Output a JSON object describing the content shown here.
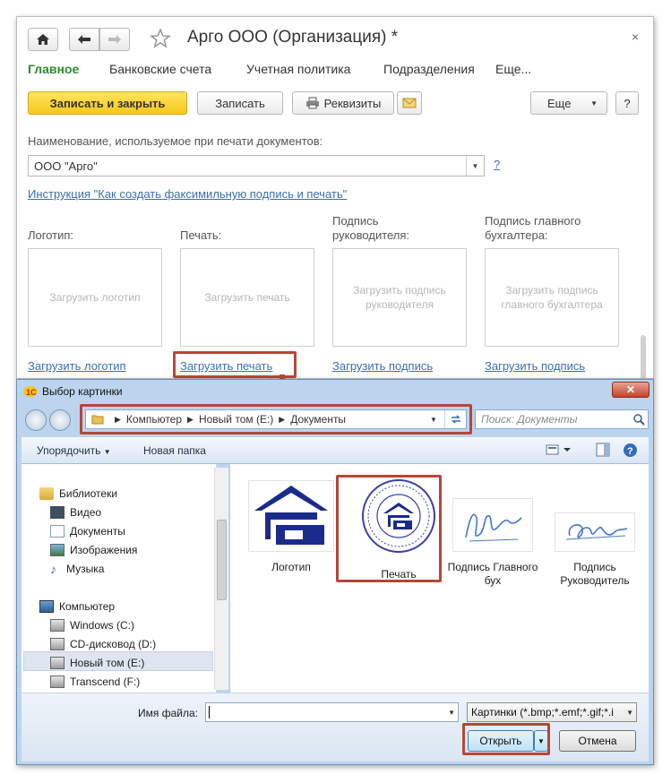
{
  "window": {
    "title": "Арго ООО (Организация) *",
    "close_glyph": "×",
    "tabs": [
      "Главное",
      "Банковские счета",
      "Учетная политика",
      "Подразделения",
      "Еще..."
    ],
    "toolbar": {
      "save_close": "Записать и закрыть",
      "save": "Записать",
      "details": "Реквизиты",
      "more": "Еще",
      "help": "?"
    },
    "print_name_label": "Наименование, используемое при печати документов:",
    "print_name_value": "ООО \"Арго\"",
    "help_link": "?",
    "instruction_link": "Инструкция \"Как создать факсимильную подпись и печать\"",
    "images": [
      {
        "label": "Логотип:",
        "placeholder": "Загрузить логотип",
        "link": "Загрузить логотип"
      },
      {
        "label": "Печать:",
        "placeholder": "Загрузить печать",
        "link": "Загрузить печать"
      },
      {
        "label": "Подпись руководителя:",
        "placeholder": "Загрузить  подпись руководителя",
        "link": "Загрузить подпись"
      },
      {
        "label": "Подпись главного бухгалтера:",
        "placeholder": "Загрузить подпись главного бухгалтера",
        "link": "Загрузить подпись"
      }
    ]
  },
  "dialog": {
    "title": "Выбор картинки",
    "address": [
      "Компьютер",
      "Новый том (E:)",
      "Документы"
    ],
    "search_placeholder": "Поиск: Документы",
    "toolbar": {
      "organize": "Упорядочить",
      "new_folder": "Новая папка"
    },
    "tree": {
      "libraries": "Библиотеки",
      "library_items": [
        "Видео",
        "Документы",
        "Изображения",
        "Музыка"
      ],
      "computer": "Компьютер",
      "drives": [
        "Windows (C:)",
        "CD-дисковод (D:)",
        "Новый том (E:)",
        "Transcend (F:)"
      ],
      "selected_drive": "Новый том (E:)"
    },
    "files": [
      {
        "name": "Логотип",
        "icon": "logo-house-image"
      },
      {
        "name": "Печать",
        "icon": "stamp-image"
      },
      {
        "name": "Подпись Главного бух",
        "icon": "signature-image"
      },
      {
        "name": "Подпись Руководитель",
        "icon": "signature-image"
      }
    ],
    "file_name_label": "Имя файла:",
    "file_name_value": "",
    "filter": "Картинки (*.bmp;*.emf;*.gif;*.i",
    "open_button": "Открыть",
    "cancel_button": "Отмена"
  },
  "colors": {
    "accent_green": "#2f8a2f",
    "link_blue": "#3a6fb0",
    "highlight_red": "#b5473a",
    "primary_yellow": "#f6c81c"
  }
}
